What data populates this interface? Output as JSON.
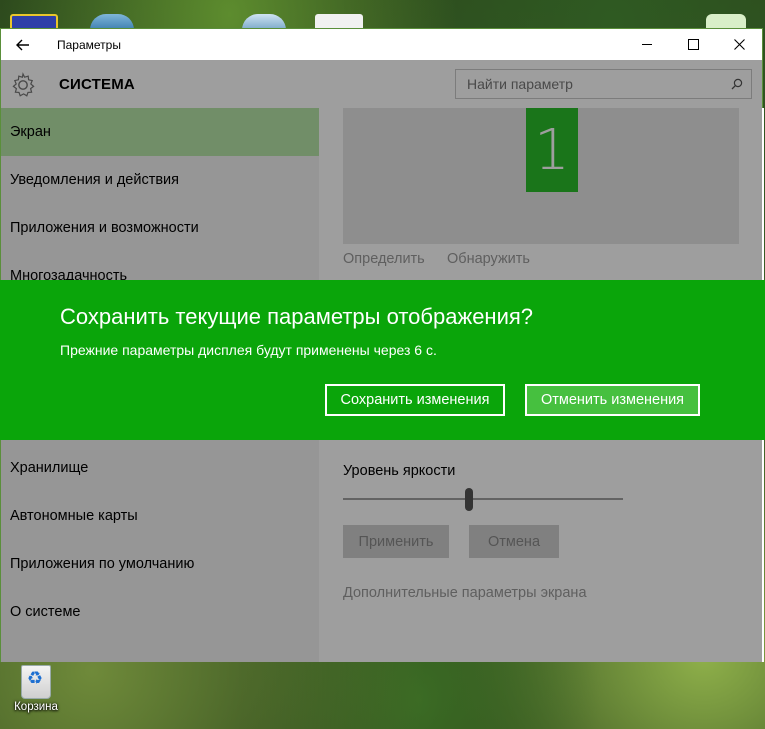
{
  "window": {
    "title": "Параметры",
    "controls": {
      "minimize": "—",
      "maximize": "☐",
      "close": "✕"
    }
  },
  "header": {
    "section_title": "СИСТЕМА",
    "search_placeholder": "Найти параметр"
  },
  "sidebar": {
    "items": [
      {
        "label": "Экран",
        "active": true
      },
      {
        "label": "Уведомления и действия",
        "active": false
      },
      {
        "label": "Приложения и возможности",
        "active": false
      },
      {
        "label": "Многозадачность",
        "active": false
      },
      {
        "label": "Хранилище",
        "active": false
      },
      {
        "label": "Автономные карты",
        "active": false
      },
      {
        "label": "Приложения по умолчанию",
        "active": false
      },
      {
        "label": "О системе",
        "active": false
      }
    ]
  },
  "content": {
    "monitor_number": "1",
    "identify_link": "Определить",
    "detect_link": "Обнаружить",
    "brightness_label": "Уровень яркости",
    "brightness_value": 0.45,
    "apply_button": "Применить",
    "cancel_button": "Отмена",
    "advanced_link": "Дополнительные параметры экрана"
  },
  "confirm_dialog": {
    "title": "Сохранить текущие параметры отображения?",
    "message": "Прежние параметры дисплея будут применены через  6 с.",
    "keep_button": "Сохранить изменения",
    "revert_button": "Отменить изменения"
  },
  "desktop": {
    "recycle_bin_label": "Корзина"
  },
  "colors": {
    "accent": "#0aa50a",
    "active_nav": "#b7e6a8",
    "monitor_tile": "#2bbd2b"
  }
}
